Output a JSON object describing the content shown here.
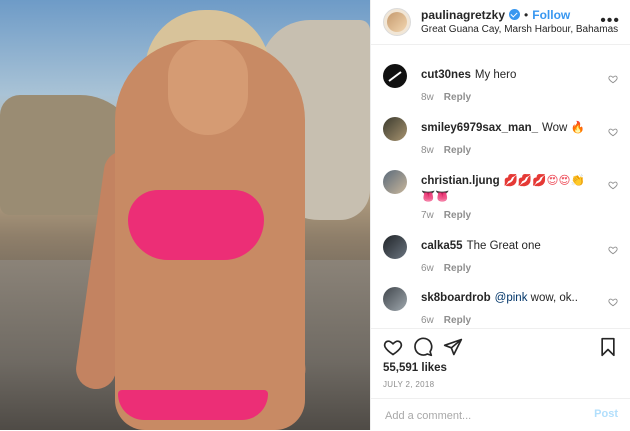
{
  "post": {
    "username": "paulinagretzky",
    "follow_label": "Follow",
    "dot": "•",
    "location": "Great Guana Cay, Marsh Harbour, Bahamas",
    "more_label": "•••",
    "colors": {
      "accent": "#3897f0",
      "bikini": "#ec2e76"
    }
  },
  "comments": [
    {
      "user": "cut30nes",
      "text": "My hero",
      "time": "8w",
      "reply": "Reply"
    },
    {
      "user": "smiley6979sax_man_",
      "text": "Wow 🔥",
      "time": "8w",
      "reply": "Reply"
    },
    {
      "user": "christian.ljung",
      "text": "💋💋💋😍😍👏👅👅",
      "time": "7w",
      "reply": "Reply"
    },
    {
      "user": "calka55",
      "text": "The Great one",
      "time": "6w",
      "reply": "Reply"
    },
    {
      "user": "sk8boardrob",
      "mention": "@pink",
      "text": " wow, ok..",
      "time": "6w",
      "reply": "Reply"
    }
  ],
  "actions": {
    "icons": [
      "heart-icon",
      "comment-icon",
      "share-icon",
      "bookmark-icon"
    ]
  },
  "likes": "55,591 likes",
  "date": "JULY 2, 2018",
  "add_comment": {
    "placeholder": "Add a comment...",
    "post_label": "Post"
  }
}
